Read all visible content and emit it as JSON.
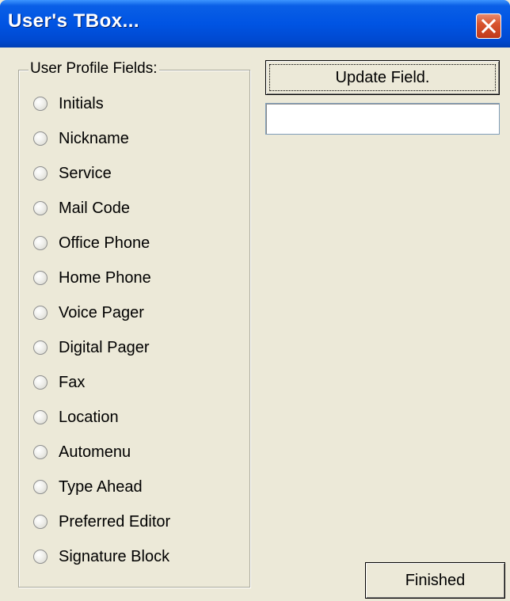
{
  "window": {
    "title": "User's TBox..."
  },
  "group": {
    "legend": "User Profile Fields:",
    "options": [
      "Initials",
      "Nickname",
      "Service",
      "Mail Code",
      "Office Phone",
      "Home Phone",
      "Voice Pager",
      "Digital Pager",
      "Fax",
      "Location",
      "Automenu",
      "Type Ahead",
      "Preferred Editor",
      "Signature Block"
    ]
  },
  "actions": {
    "update_label": "Update Field.",
    "finished_label": "Finished"
  },
  "field": {
    "value": ""
  },
  "icons": {
    "close": "close-icon",
    "radio": "radio-button"
  },
  "colors": {
    "titlebar": "#0054e3",
    "close": "#d8542e",
    "dialog_bg": "#ece9d8"
  }
}
